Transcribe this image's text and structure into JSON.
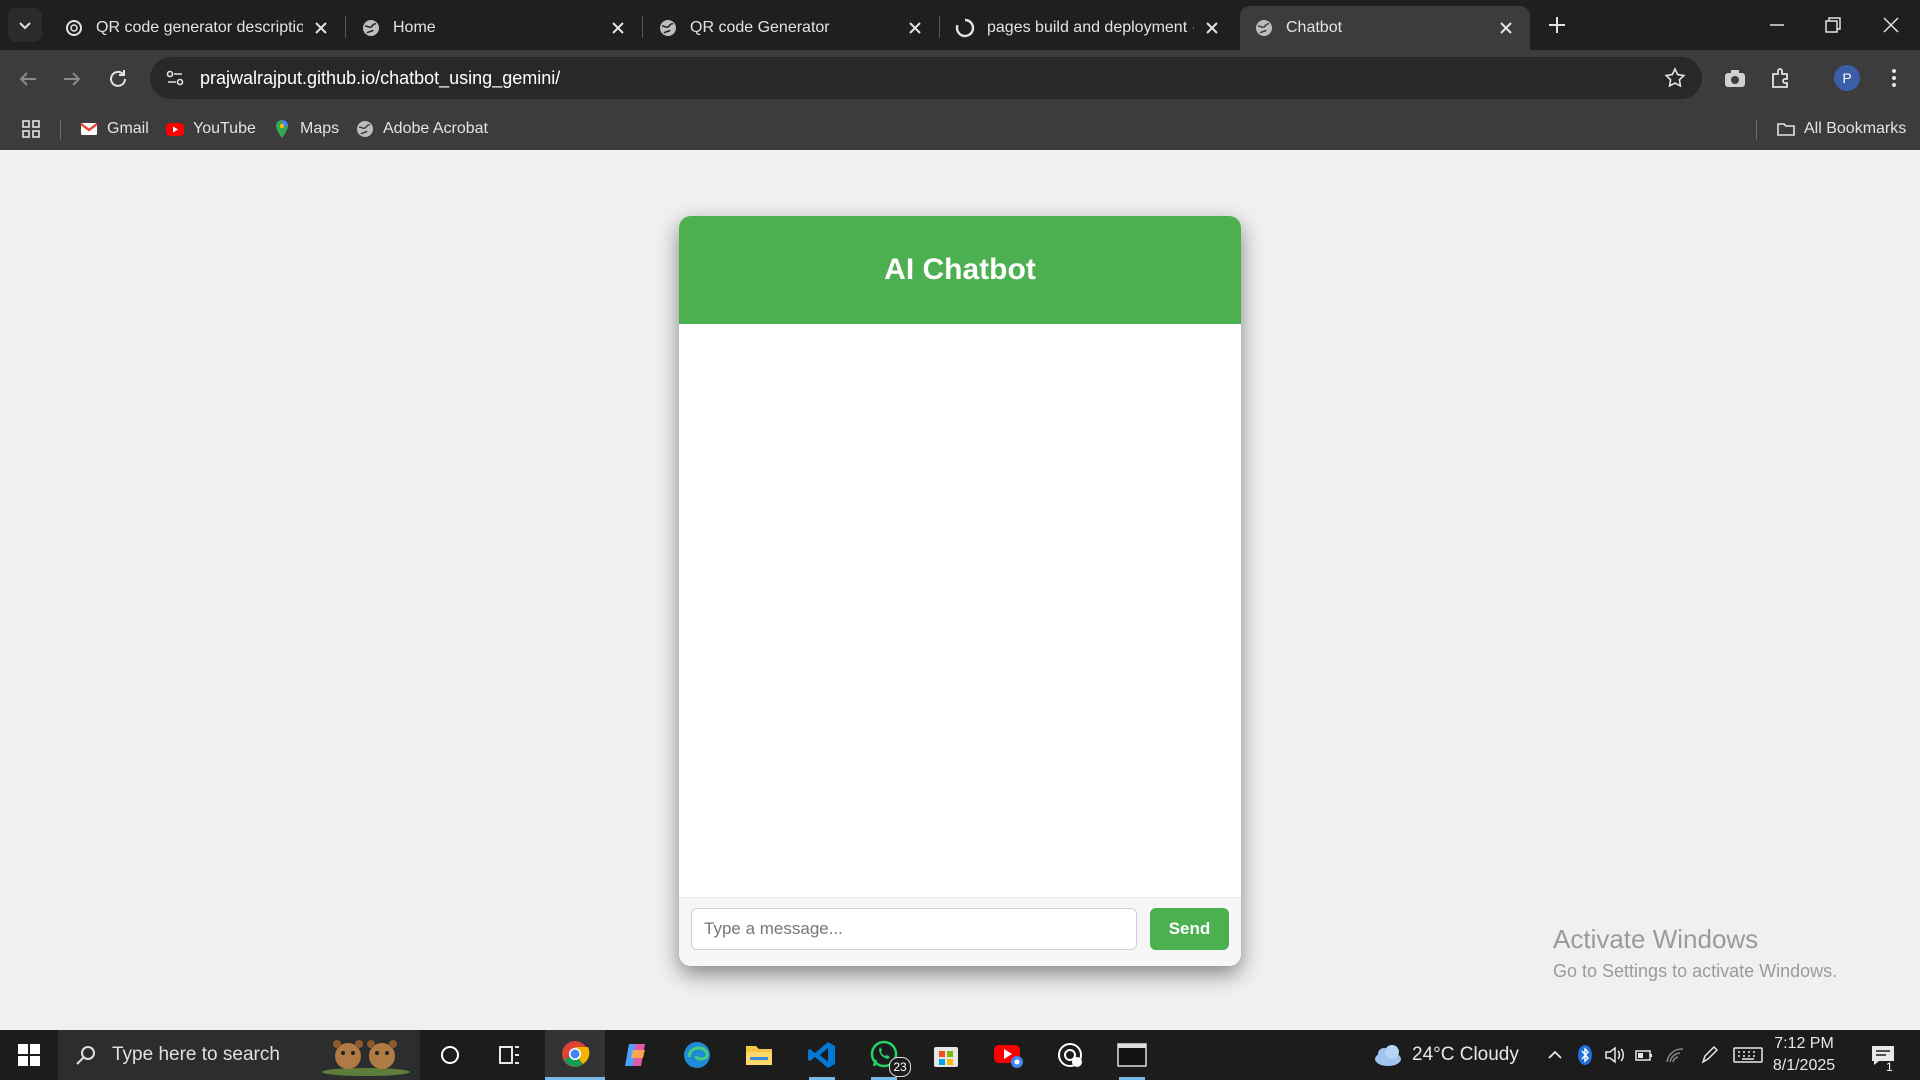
{
  "browser": {
    "tabs": [
      {
        "title": "QR code generator description",
        "favicon": "openai-icon",
        "active": false
      },
      {
        "title": "Home",
        "favicon": "globe-icon",
        "active": false
      },
      {
        "title": "QR code Generator",
        "favicon": "globe-icon",
        "active": false
      },
      {
        "title": "pages build and deployment · p",
        "favicon": "github-loading-icon",
        "active": false
      },
      {
        "title": "Chatbot",
        "favicon": "globe-icon",
        "active": true
      }
    ],
    "url": "prajwalrajput.github.io/chatbot_using_gemini/",
    "profile_initial": "P",
    "bookmarks": [
      {
        "label": "Gmail",
        "icon": "gmail-icon"
      },
      {
        "label": "YouTube",
        "icon": "youtube-icon"
      },
      {
        "label": "Maps",
        "icon": "maps-icon"
      },
      {
        "label": "Adobe Acrobat",
        "icon": "globe-icon"
      }
    ],
    "all_bookmarks_label": "All Bookmarks"
  },
  "chat": {
    "title": "AI Chatbot",
    "input_placeholder": "Type a message...",
    "input_value": "",
    "send_label": "Send",
    "accent_color": "#4caf50"
  },
  "watermark": {
    "line1": "Activate Windows",
    "line2": "Go to Settings to activate Windows."
  },
  "taskbar": {
    "search_placeholder": "Type here to search",
    "whatsapp_badge": "23",
    "weather": "24°C  Cloudy",
    "time": "7:12 PM",
    "date": "8/1/2025",
    "notification_count": "1"
  }
}
